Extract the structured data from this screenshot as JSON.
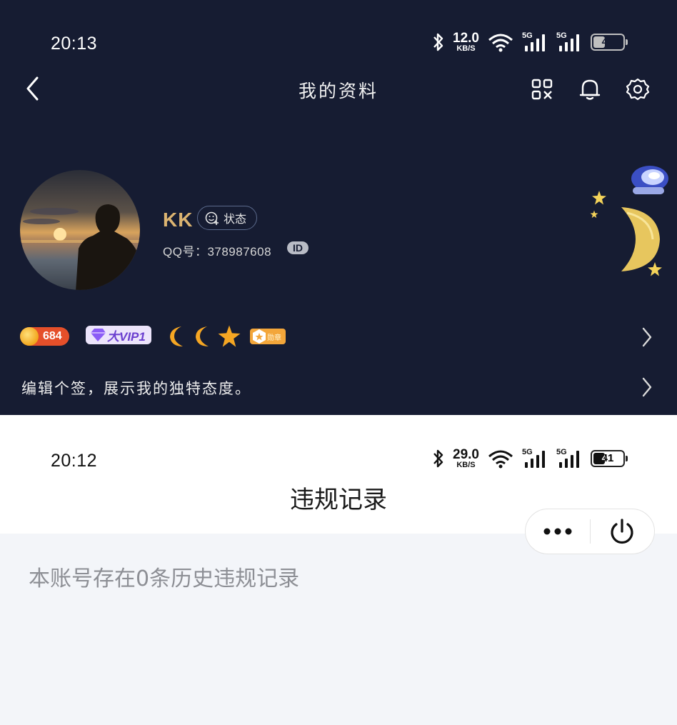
{
  "top_screen": {
    "status_bar": {
      "time": "20:13",
      "net_speed": "12.0",
      "net_unit": "KB/S",
      "sig1_label": "5G",
      "sig2_label": "5G",
      "battery": "41"
    },
    "header": {
      "title": "我的资料"
    },
    "profile": {
      "nickname": "KK",
      "status_label": "状态",
      "qq_label": "QQ号：378987608",
      "id_badge": "ID",
      "coin_count": "684",
      "vip_label": "大VIP1",
      "medal_label": "勋章",
      "signature": "编辑个签，展示我的独特态度。"
    }
  },
  "bottom_screen": {
    "status_bar": {
      "time": "20:12",
      "net_speed": "29.0",
      "net_unit": "KB/S",
      "sig1_label": "5G",
      "sig2_label": "5G",
      "battery": "41"
    },
    "header": {
      "title": "违规记录"
    },
    "content": {
      "record_text": "本账号存在0条历史违规记录"
    }
  },
  "colors": {
    "top_bg": "#161c32",
    "gold_name": "#dcb471",
    "content_bg": "#f3f5f9"
  },
  "icons": [
    "back-arrow-icon",
    "qr-code-icon",
    "bell-icon",
    "gear-icon",
    "smiley-plus-icon",
    "chevron-right-icon",
    "more-dots-icon",
    "power-icon",
    "bluetooth-icon",
    "wifi-icon",
    "signal-icon",
    "battery-icon",
    "moon-icon",
    "star-icon",
    "astronaut-icon"
  ]
}
